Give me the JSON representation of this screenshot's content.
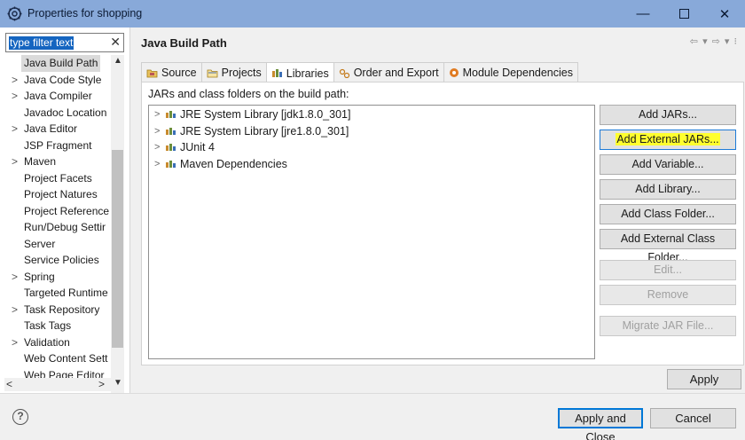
{
  "window": {
    "title": "Properties for shopping",
    "icons": {
      "app": "gear-icon",
      "minimize": "minimize-icon",
      "maximize": "maximize-icon",
      "close": "close-icon"
    },
    "minimize_glyph": "—",
    "close_glyph": "✕"
  },
  "filter": {
    "value": "type filter text",
    "clear_glyph": "✕"
  },
  "tree": {
    "items": [
      {
        "label": "Java Build Path",
        "expandable": false,
        "selected": true
      },
      {
        "label": "Java Code Style",
        "expandable": true
      },
      {
        "label": "Java Compiler",
        "expandable": true
      },
      {
        "label": "Javadoc Location",
        "expandable": false
      },
      {
        "label": "Java Editor",
        "expandable": true
      },
      {
        "label": "JSP Fragment",
        "expandable": false
      },
      {
        "label": "Maven",
        "expandable": true
      },
      {
        "label": "Project Facets",
        "expandable": false
      },
      {
        "label": "Project Natures",
        "expandable": false
      },
      {
        "label": "Project Reference",
        "expandable": false
      },
      {
        "label": "Run/Debug Settir",
        "expandable": false
      },
      {
        "label": "Server",
        "expandable": false
      },
      {
        "label": "Service Policies",
        "expandable": false
      },
      {
        "label": "Spring",
        "expandable": true
      },
      {
        "label": "Targeted Runtime",
        "expandable": false
      },
      {
        "label": "Task Repository",
        "expandable": true
      },
      {
        "label": "Task Tags",
        "expandable": false
      },
      {
        "label": "Validation",
        "expandable": true
      },
      {
        "label": "Web Content Sett",
        "expandable": false
      },
      {
        "label": "Web Page Editor",
        "expandable": false
      }
    ],
    "expand_glyph": ">"
  },
  "page": {
    "title": "Java Build Path",
    "nav_glyphs": "⇦ ▾ ⇨ ▾ ⁝"
  },
  "tabs": [
    {
      "label": "Source",
      "icon": "source-folder-icon",
      "active": false
    },
    {
      "label": "Projects",
      "icon": "projects-icon",
      "active": false
    },
    {
      "label": "Libraries",
      "icon": "libraries-icon",
      "active": true
    },
    {
      "label": "Order and Export",
      "icon": "order-export-icon",
      "active": false
    },
    {
      "label": "Module Dependencies",
      "icon": "module-icon",
      "active": false
    }
  ],
  "libraries": {
    "caption": "JARs and class folders on the build path:",
    "entries": [
      "JRE System Library [jdk1.8.0_301]",
      "JRE System Library [jre1.8.0_301]",
      "JUnit 4",
      "Maven Dependencies"
    ]
  },
  "buttons": {
    "add_jars": "Add JARs...",
    "add_external_jars": "Add External JARs...",
    "add_variable": "Add Variable...",
    "add_library": "Add Library...",
    "add_class_folder": "Add Class Folder...",
    "add_external_class_folder": "Add External Class Folder...",
    "edit": "Edit...",
    "remove": "Remove",
    "migrate_jar": "Migrate JAR File...",
    "apply": "Apply",
    "apply_and_close": "Apply and Close",
    "cancel": "Cancel"
  },
  "footer": {
    "help_glyph": "?"
  },
  "colors": {
    "titlebar": "#88a9d9",
    "highlight": "#ffff2e",
    "selection": "#1565c0",
    "primary_border": "#0078d7"
  }
}
